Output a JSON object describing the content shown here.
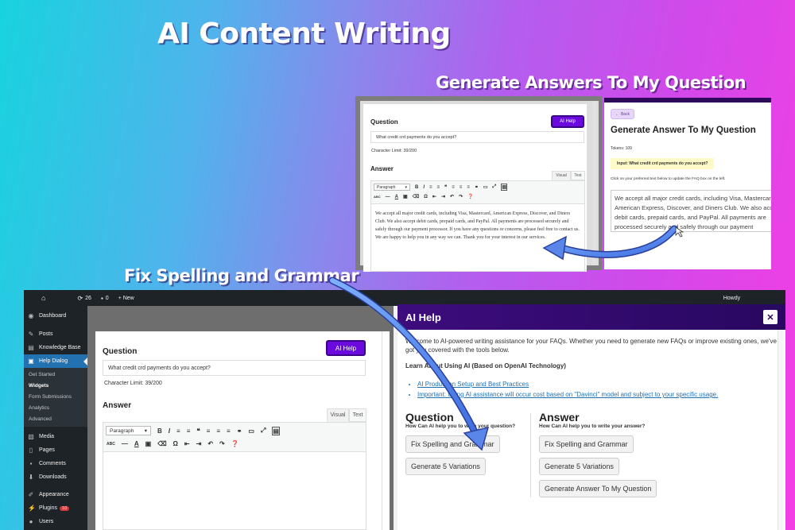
{
  "titles": {
    "main": "AI Content Writing",
    "generate": "Generate Answers To My Question",
    "fix": "Fix Spelling and Grammar"
  },
  "top_left": {
    "question_label": "Question",
    "ai_help": "AI Help",
    "question_value": "What credit crd payments do you accept?",
    "char_limit": "Character Limit: 39/200",
    "answer_label": "Answer",
    "tab_visual": "Visual",
    "tab_text": "Text",
    "paragraph": "Paragraph",
    "answer_text": "We accept all major credit cards, including Visa, Mastercard, American Express, Discover, and Diners Club. We also accept debit cards, prepaid cards, and PayPal. All payments are processed securely and safely through our payment processor. If you have any questions or concerns, please feel free to contact us. We are happy to help you in any way we can. Thank you for your interest in our services."
  },
  "top_right": {
    "back": "Back",
    "heading": "Generate Answer To My Question",
    "tokens": "Tokens: 109",
    "input_label": "Input: What credit crd payments do you accept?",
    "instruction": "Click on your preferred text below to update the FAQ box on the left.",
    "result": "We accept all major credit cards, including Visa, Mastercard, American Express, Discover, and Diners Club. We also accept debit cards, prepaid cards, and PayPal. All payments are processed securely and safely through our payment processor. If you have any questions or concerns, please feel free to contact us. We are happy to help you in any way we can. Thank you for your interest in our services."
  },
  "adminbar": {
    "updates": "26",
    "comments": "0",
    "new": "+ New",
    "howdy": "Howdy"
  },
  "sidebar": {
    "dashboard": "Dashboard",
    "posts": "Posts",
    "knowledge_base": "Knowledge Base",
    "help_dialog": "Help Dialog",
    "sub": [
      "Get Started",
      "Widgets",
      "Form Submissions",
      "Analytics",
      "Advanced"
    ],
    "media": "Media",
    "pages": "Pages",
    "comments": "Comments",
    "downloads": "Downloads",
    "appearance": "Appearance",
    "plugins": "Plugins",
    "plugins_badge": "10",
    "users": "Users"
  },
  "editor": {
    "question_label": "Question",
    "ai_help": "AI Help",
    "question_value": "What credit crd payments do you accept?",
    "char_limit": "Character Limit: 39/200",
    "answer_label": "Answer",
    "tab_visual": "Visual",
    "tab_text": "Text",
    "paragraph": "Paragraph"
  },
  "modal": {
    "title": "AI Help",
    "intro": "Welcome to AI-powered writing assistance for your FAQs. Whether you need to generate new FAQs or improve existing ones, we've got you covered with the tools below.",
    "learn_heading": "Learn About Using AI (Based on OpenAI Technology)",
    "links": [
      "AI Production Setup and Best Practices",
      "Important: Using AI assistance will occur cost based on \"Davinci\" model and subject to your specific usage."
    ],
    "question_col": {
      "heading": "Question",
      "sub": "How Can AI help you to write your question?",
      "buttons": [
        "Fix Spelling and Grammar",
        "Generate 5 Variations"
      ]
    },
    "answer_col": {
      "heading": "Answer",
      "sub": "How Can AI help you to write your answer?",
      "buttons": [
        "Fix Spelling and Grammar",
        "Generate 5 Variations",
        "Generate Answer To My Question"
      ]
    }
  },
  "colors": {
    "accent_purple": "#6a0adf",
    "modal_header": "#3d0c7d",
    "wp_admin": "#1d2327",
    "wp_active": "#2271b1"
  }
}
